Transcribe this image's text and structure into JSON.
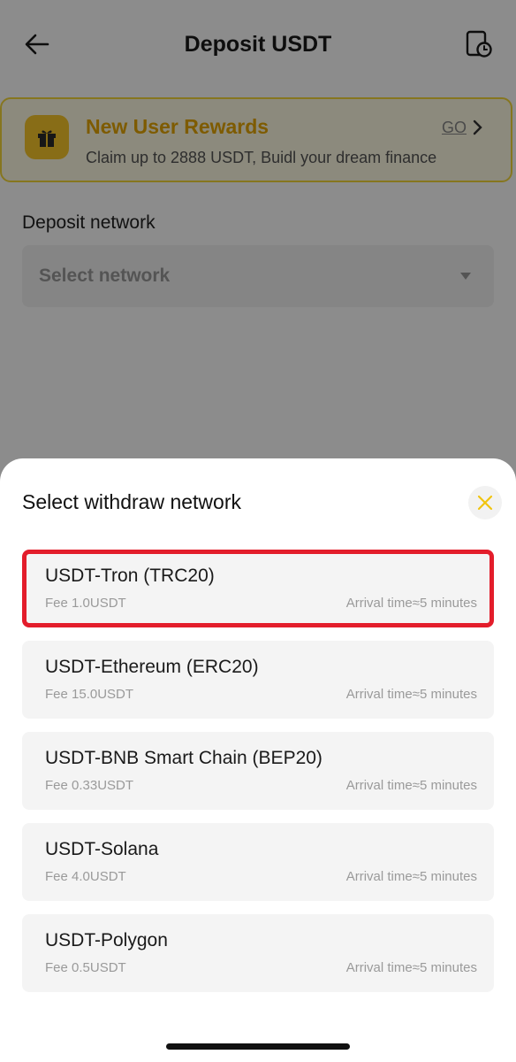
{
  "header": {
    "title": "Deposit USDT",
    "back_icon": "arrow-left-icon",
    "history_icon": "history-record-icon"
  },
  "promo": {
    "title": "New User Rewards",
    "subtitle": "Claim up to 2888 USDT, Buidl your dream finance",
    "go_label": "GO",
    "icon": "gift-icon",
    "accent_color": "#e6a700"
  },
  "deposit_network": {
    "label": "Deposit network",
    "placeholder": "Select network"
  },
  "sheet": {
    "title": "Select withdraw network",
    "close_icon": "close-icon",
    "networks": [
      {
        "name": "USDT-Tron (TRC20)",
        "fee": "Fee 1.0USDT",
        "arrival": "Arrival time≈5 minutes",
        "highlighted": true
      },
      {
        "name": "USDT-Ethereum (ERC20)",
        "fee": "Fee 15.0USDT",
        "arrival": "Arrival time≈5 minutes",
        "highlighted": false
      },
      {
        "name": "USDT-BNB Smart Chain (BEP20)",
        "fee": "Fee 0.33USDT",
        "arrival": "Arrival time≈5 minutes",
        "highlighted": false
      },
      {
        "name": "USDT-Solana",
        "fee": "Fee 4.0USDT",
        "arrival": "Arrival time≈5 minutes",
        "highlighted": false
      },
      {
        "name": "USDT-Polygon",
        "fee": "Fee 0.5USDT",
        "arrival": "Arrival time≈5 minutes",
        "highlighted": false
      }
    ],
    "highlight_color": "#e31d2b"
  }
}
